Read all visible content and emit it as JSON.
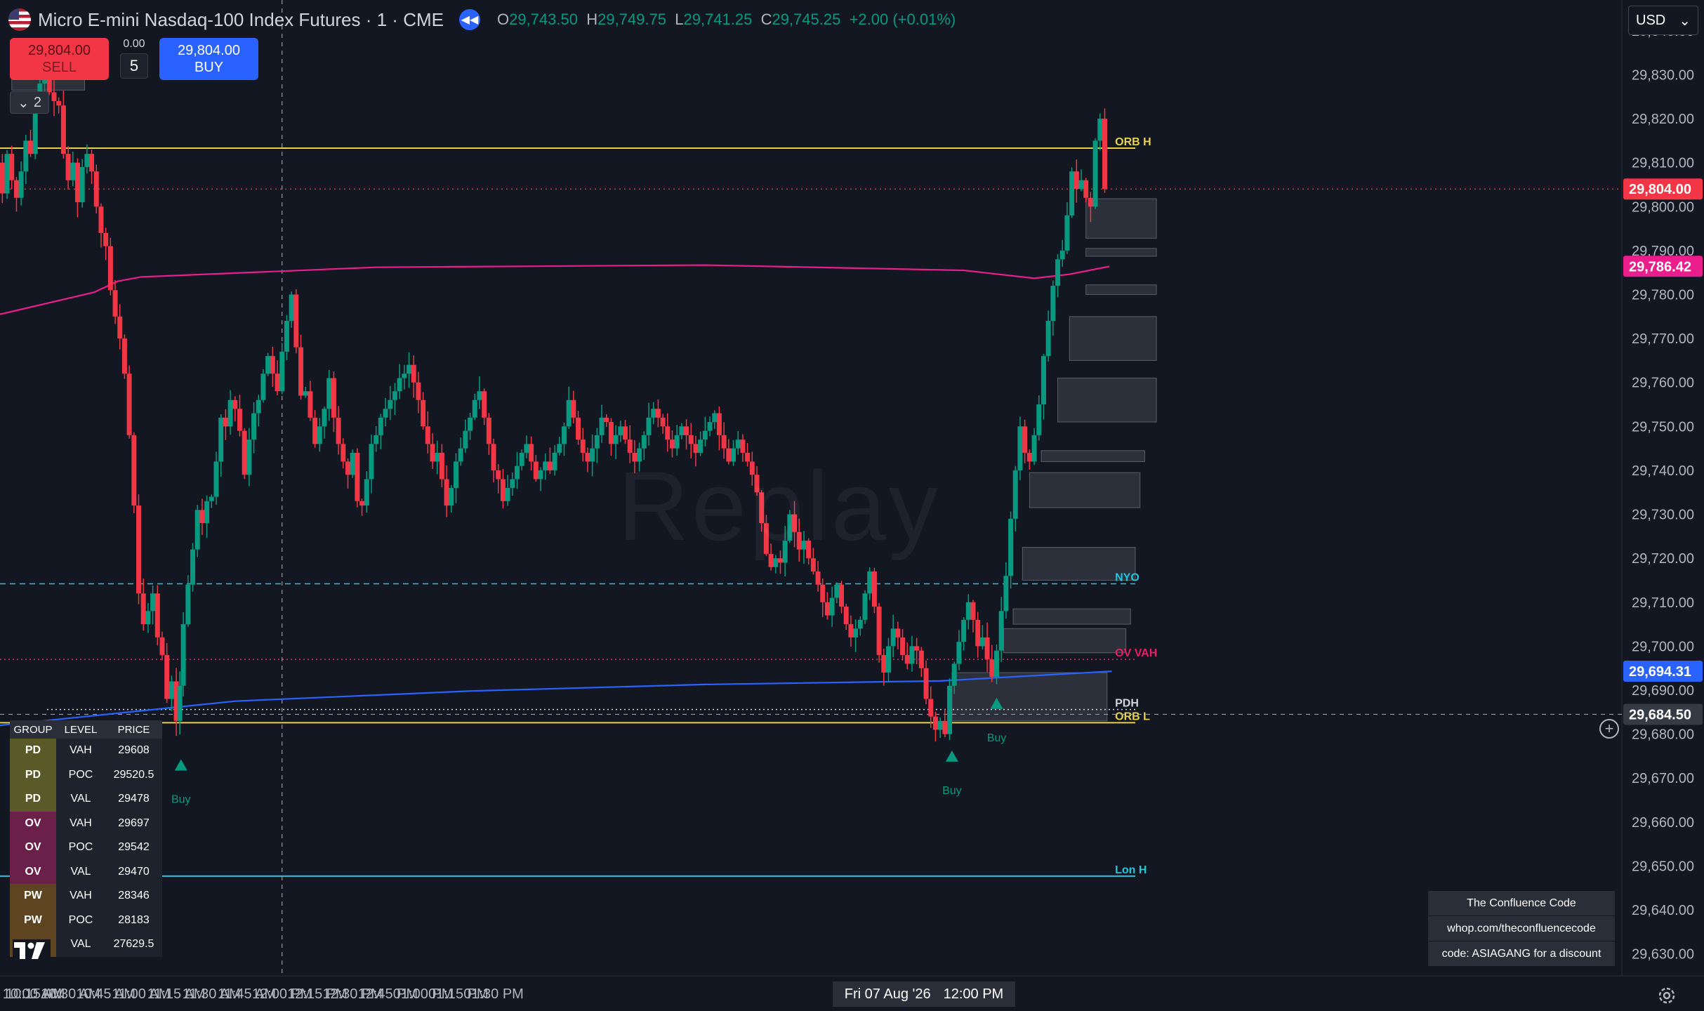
{
  "header": {
    "symbol": "Micro E-mini Nasdaq-100 Index Futures · 1 · CME",
    "o_label": "O",
    "o": "29,743.50",
    "h_label": "H",
    "h": "29,749.75",
    "l_label": "L",
    "l": "29,741.25",
    "c_label": "C",
    "c": "29,745.25",
    "change": "+2.00 (+0.01%)"
  },
  "trade": {
    "sell_price": "29,804.00",
    "sell_label": "SELL",
    "spread": "0.00",
    "qty": "5",
    "buy_price": "29,804.00",
    "buy_label": "BUY"
  },
  "toolbar": {
    "collapse_count": "2",
    "currency": "USD"
  },
  "watermark": "Replay",
  "date_flag": {
    "date": "Fri 07 Aug '26",
    "time": "12:00 PM"
  },
  "levels_table": {
    "headers": [
      "GROUP",
      "LEVEL",
      "PRICE"
    ],
    "rows": [
      {
        "group": "PD",
        "level": "VAH",
        "price": "29608"
      },
      {
        "group": "PD",
        "level": "POC",
        "price": "29520.5"
      },
      {
        "group": "PD",
        "level": "VAL",
        "price": "29478"
      },
      {
        "group": "OV",
        "level": "VAH",
        "price": "29697"
      },
      {
        "group": "OV",
        "level": "POC",
        "price": "29542"
      },
      {
        "group": "OV",
        "level": "VAL",
        "price": "29470"
      },
      {
        "group": "PW",
        "level": "VAH",
        "price": "28346"
      },
      {
        "group": "PW",
        "level": "POC",
        "price": "28183"
      },
      {
        "group": "PW",
        "level": "VAL",
        "price": "27629.5"
      }
    ]
  },
  "promo": [
    "The Confluence Code",
    "whop.com/theconfluencecode",
    "code: ASIAGANG for a discount"
  ],
  "colors": {
    "up": "#089981",
    "down": "#f23645",
    "bg": "#131722",
    "orb": "#e8d24a",
    "vwap": "#e91e8c",
    "blue_line": "#2962ff",
    "nyo": "#26c6da",
    "lon": "#26c6da",
    "ov_vah": "#e91e63"
  },
  "chart_data": {
    "type": "candlestick",
    "interval": "1 minute",
    "x_axis_labels": [
      "10:00 AM",
      "10:15 AM",
      "10:30 AM",
      "10:45 AM",
      "11:00 AM",
      "11:15 AM",
      "11:30 AM",
      "11:45 AM",
      "12:00 PM",
      "12:15 PM",
      "12:30 PM",
      "12:45 PM",
      "01:00 PM",
      "01:15 PM",
      "01:30 PM"
    ],
    "x_start_minutes": 600,
    "x_end_minutes": 1290,
    "y_axis_labels": [
      "29,840.00",
      "29,830.00",
      "29,820.00",
      "29,810.00",
      "29,800.00",
      "29,790.00",
      "29,780.00",
      "29,770.00",
      "29,760.00",
      "29,750.00",
      "29,740.00",
      "29,730.00",
      "29,720.00",
      "29,710.00",
      "29,700.00",
      "29,690.00",
      "29,680.00",
      "29,670.00",
      "29,660.00",
      "29,650.00",
      "29,640.00",
      "29,630.00"
    ],
    "ylim": [
      29625,
      29847
    ],
    "close_path": [
      [
        600,
        29810
      ],
      [
        602,
        29803
      ],
      [
        604,
        29812
      ],
      [
        606,
        29806
      ],
      [
        608,
        29802
      ],
      [
        610,
        29808
      ],
      [
        612,
        29815
      ],
      [
        614,
        29812
      ],
      [
        616,
        29823
      ],
      [
        618,
        29828
      ],
      [
        620,
        29830
      ],
      [
        622,
        29826
      ],
      [
        624,
        29824
      ],
      [
        626,
        29823
      ],
      [
        628,
        29812
      ],
      [
        630,
        29806
      ],
      [
        632,
        29810
      ],
      [
        634,
        29801
      ],
      [
        636,
        29809
      ],
      [
        638,
        29812
      ],
      [
        640,
        29808
      ],
      [
        642,
        29800
      ],
      [
        644,
        29794
      ],
      [
        646,
        29791
      ],
      [
        648,
        29781
      ],
      [
        650,
        29775
      ],
      [
        652,
        29770
      ],
      [
        654,
        29762
      ],
      [
        656,
        29748
      ],
      [
        658,
        29732
      ],
      [
        660,
        29712
      ],
      [
        662,
        29705
      ],
      [
        664,
        29708
      ],
      [
        666,
        29712
      ],
      [
        668,
        29702
      ],
      [
        670,
        29698
      ],
      [
        672,
        29688
      ],
      [
        674,
        29692
      ],
      [
        676,
        29683
      ],
      [
        677,
        29691
      ],
      [
        679,
        29705
      ],
      [
        681,
        29714
      ],
      [
        683,
        29722
      ],
      [
        685,
        29731
      ],
      [
        687,
        29728
      ],
      [
        689,
        29733
      ],
      [
        691,
        29734
      ],
      [
        693,
        29742
      ],
      [
        695,
        29752
      ],
      [
        697,
        29750
      ],
      [
        699,
        29756
      ],
      [
        701,
        29754
      ],
      [
        703,
        29749
      ],
      [
        705,
        29739
      ],
      [
        707,
        29747
      ],
      [
        709,
        29753
      ],
      [
        711,
        29756
      ],
      [
        713,
        29762
      ],
      [
        715,
        29766
      ],
      [
        717,
        29762
      ],
      [
        719,
        29758
      ],
      [
        721,
        29767
      ],
      [
        723,
        29774
      ],
      [
        725,
        29780
      ],
      [
        727,
        29768
      ],
      [
        729,
        29757
      ],
      [
        731,
        29758
      ],
      [
        733,
        29752
      ],
      [
        735,
        29746
      ],
      [
        737,
        29750
      ],
      [
        739,
        29754
      ],
      [
        741,
        29761
      ],
      [
        743,
        29752
      ],
      [
        745,
        29746
      ],
      [
        747,
        29742
      ],
      [
        749,
        29739
      ],
      [
        751,
        29744
      ],
      [
        753,
        29733
      ],
      [
        755,
        29732
      ],
      [
        757,
        29738
      ],
      [
        759,
        29746
      ],
      [
        761,
        29748
      ],
      [
        763,
        29752
      ],
      [
        765,
        29754
      ],
      [
        767,
        29756
      ],
      [
        769,
        29758
      ],
      [
        771,
        29761
      ],
      [
        773,
        29762
      ],
      [
        775,
        29764
      ],
      [
        777,
        29760
      ],
      [
        779,
        29756
      ],
      [
        781,
        29750
      ],
      [
        783,
        29746
      ],
      [
        785,
        29742
      ],
      [
        787,
        29744
      ],
      [
        789,
        29738
      ],
      [
        791,
        29732
      ],
      [
        793,
        29736
      ],
      [
        795,
        29742
      ],
      [
        797,
        29745
      ],
      [
        799,
        29749
      ],
      [
        801,
        29752
      ],
      [
        803,
        29756
      ],
      [
        805,
        29758
      ],
      [
        807,
        29752
      ],
      [
        809,
        29746
      ],
      [
        811,
        29740
      ],
      [
        813,
        29738
      ],
      [
        815,
        29733
      ],
      [
        817,
        29736
      ],
      [
        819,
        29738
      ],
      [
        821,
        29741
      ],
      [
        823,
        29744
      ],
      [
        825,
        29746
      ],
      [
        827,
        29742
      ],
      [
        829,
        29738
      ],
      [
        831,
        29740
      ],
      [
        833,
        29742
      ],
      [
        835,
        29740
      ],
      [
        837,
        29744
      ],
      [
        839,
        29746
      ],
      [
        841,
        29750
      ],
      [
        843,
        29756
      ],
      [
        845,
        29752
      ],
      [
        847,
        29747
      ],
      [
        849,
        29744
      ],
      [
        851,
        29742
      ],
      [
        853,
        29745
      ],
      [
        855,
        29748
      ],
      [
        857,
        29752
      ],
      [
        859,
        29751
      ],
      [
        861,
        29746
      ],
      [
        863,
        29748
      ],
      [
        865,
        29750
      ],
      [
        867,
        29747
      ],
      [
        869,
        29744
      ],
      [
        871,
        29742
      ],
      [
        873,
        29745
      ],
      [
        875,
        29748
      ],
      [
        877,
        29752
      ],
      [
        879,
        29754
      ],
      [
        881,
        29752
      ],
      [
        883,
        29750
      ],
      [
        885,
        29747
      ],
      [
        887,
        29745
      ],
      [
        889,
        29748
      ],
      [
        891,
        29750
      ],
      [
        893,
        29748
      ],
      [
        895,
        29746
      ],
      [
        897,
        29744
      ],
      [
        899,
        29747
      ],
      [
        901,
        29749
      ],
      [
        903,
        29751
      ],
      [
        905,
        29753
      ],
      [
        907,
        29748
      ],
      [
        909,
        29745
      ],
      [
        911,
        29742
      ],
      [
        913,
        29745
      ],
      [
        915,
        29747
      ],
      [
        917,
        29744
      ],
      [
        919,
        29742
      ],
      [
        921,
        29739
      ],
      [
        923,
        29735
      ],
      [
        925,
        29728
      ],
      [
        927,
        29721
      ],
      [
        929,
        29718
      ],
      [
        931,
        29720
      ],
      [
        933,
        29719
      ],
      [
        935,
        29724
      ],
      [
        937,
        29730
      ],
      [
        939,
        29726
      ],
      [
        941,
        29722
      ],
      [
        943,
        29724
      ],
      [
        945,
        29720
      ],
      [
        947,
        29717
      ],
      [
        949,
        29714
      ],
      [
        951,
        29710
      ],
      [
        953,
        29707
      ],
      [
        955,
        29711
      ],
      [
        957,
        29714
      ],
      [
        959,
        29709
      ],
      [
        961,
        29705
      ],
      [
        963,
        29702
      ],
      [
        965,
        29704
      ],
      [
        967,
        29706
      ],
      [
        969,
        29712
      ],
      [
        971,
        29717
      ],
      [
        973,
        29709
      ],
      [
        975,
        29698
      ],
      [
        977,
        29694
      ],
      [
        979,
        29700
      ],
      [
        981,
        29704
      ],
      [
        983,
        29702
      ],
      [
        985,
        29698
      ],
      [
        987,
        29696
      ],
      [
        989,
        29700
      ],
      [
        991,
        29699
      ],
      [
        993,
        29695
      ],
      [
        995,
        29688
      ],
      [
        997,
        29684
      ],
      [
        999,
        29681
      ],
      [
        1001,
        29683
      ],
      [
        1003,
        29680
      ],
      [
        1005,
        29691
      ],
      [
        1007,
        29696
      ],
      [
        1009,
        29701
      ],
      [
        1011,
        29706
      ],
      [
        1013,
        29710
      ],
      [
        1015,
        29706
      ],
      [
        1017,
        29700
      ],
      [
        1019,
        29702
      ],
      [
        1021,
        29697
      ],
      [
        1023,
        29693
      ],
      [
        1025,
        29699
      ],
      [
        1027,
        29708
      ],
      [
        1029,
        29716
      ],
      [
        1031,
        29729
      ],
      [
        1033,
        29740
      ],
      [
        1035,
        29750
      ],
      [
        1037,
        29744
      ],
      [
        1039,
        29742
      ],
      [
        1041,
        29748
      ],
      [
        1043,
        29755
      ],
      [
        1045,
        29766
      ],
      [
        1047,
        29774
      ],
      [
        1049,
        29782
      ],
      [
        1051,
        29788
      ],
      [
        1053,
        29790
      ],
      [
        1055,
        29798
      ],
      [
        1057,
        29808
      ],
      [
        1059,
        29804
      ],
      [
        1061,
        29806
      ],
      [
        1063,
        29802
      ],
      [
        1065,
        29800
      ],
      [
        1067,
        29815
      ],
      [
        1069,
        29820
      ],
      [
        1071,
        29804
      ]
    ],
    "horizontal_levels": [
      {
        "name": "ORB H",
        "price": 29813.3,
        "color": "#e8d24a",
        "style": "solid"
      },
      {
        "name": "ORB L",
        "price": 29682.6,
        "color": "#e8d24a",
        "style": "solid"
      },
      {
        "name": "NYO",
        "price": 29714.2,
        "color": "#26c6da",
        "style": "dashed"
      },
      {
        "name": "OV VAH",
        "price": 29697.0,
        "color": "#e91e63",
        "style": "dotted"
      },
      {
        "name": "PDH",
        "price": 29685.6,
        "color": "#d1d4dc",
        "style": "dotted"
      },
      {
        "name": "Lon H",
        "price": 29647.7,
        "color": "#26c6da",
        "style": "solid"
      }
    ],
    "vwap_series": [
      [
        600,
        29775.5
      ],
      [
        640,
        29780.5
      ],
      [
        650,
        29783.0
      ],
      [
        660,
        29784.0
      ],
      [
        760,
        29786.2
      ],
      [
        900,
        29786.7
      ],
      [
        1010,
        29785.5
      ],
      [
        1040,
        29783.7
      ],
      [
        1055,
        29784.6
      ],
      [
        1072,
        29786.4
      ]
    ],
    "blue_series": [
      [
        600,
        29682.0
      ],
      [
        700,
        29687.5
      ],
      [
        800,
        29689.8
      ],
      [
        900,
        29691.3
      ],
      [
        1000,
        29692.1
      ],
      [
        1073,
        29694.3
      ]
    ],
    "current_price": {
      "label": "29,804.00",
      "price": 29804.0,
      "color": "#f23645"
    },
    "price_tags": [
      {
        "label": "29,786.42",
        "price": 29786.42,
        "color": "#e91e8c"
      },
      {
        "label": "29,694.31",
        "price": 29694.31,
        "color": "#2962ff"
      },
      {
        "label": "29,684.50",
        "price": 29684.5,
        "color": "#363a45"
      }
    ],
    "crosshair_time": 720,
    "signals": [
      {
        "label": "Buy",
        "time": 677,
        "price": 29673
      },
      {
        "label": "Buy",
        "time": 1005,
        "price": 29675
      },
      {
        "label": "Buy",
        "time": 1024,
        "price": 29687
      }
    ],
    "imbalance_zones": [
      {
        "t1": 1062,
        "t2": 1092,
        "p1": 29801.8,
        "p2": 29792.8
      },
      {
        "t1": 1062,
        "t2": 1092,
        "p1": 29790.5,
        "p2": 29788.7
      },
      {
        "t1": 1062,
        "t2": 1092,
        "p1": 29782.2,
        "p2": 29780.0
      },
      {
        "t1": 1055,
        "t2": 1092,
        "p1": 29775.0,
        "p2": 29765.0
      },
      {
        "t1": 1050,
        "t2": 1092,
        "p1": 29761.0,
        "p2": 29751.0
      },
      {
        "t1": 1043,
        "t2": 1087,
        "p1": 29744.5,
        "p2": 29742.0
      },
      {
        "t1": 1038,
        "t2": 1085,
        "p1": 29739.5,
        "p2": 29731.5
      },
      {
        "t1": 1035,
        "t2": 1083,
        "p1": 29722.5,
        "p2": 29715.0
      },
      {
        "t1": 1031,
        "t2": 1081,
        "p1": 29708.5,
        "p2": 29705.0
      },
      {
        "t1": 1027,
        "t2": 1079,
        "p1": 29704.0,
        "p2": 29698.5
      },
      {
        "t1": 1005,
        "t2": 1071,
        "p1": 29694.0,
        "p2": 29683.0
      },
      {
        "t1": 605,
        "t2": 636,
        "p1": 29829.0,
        "p2": 29826.5
      }
    ]
  }
}
